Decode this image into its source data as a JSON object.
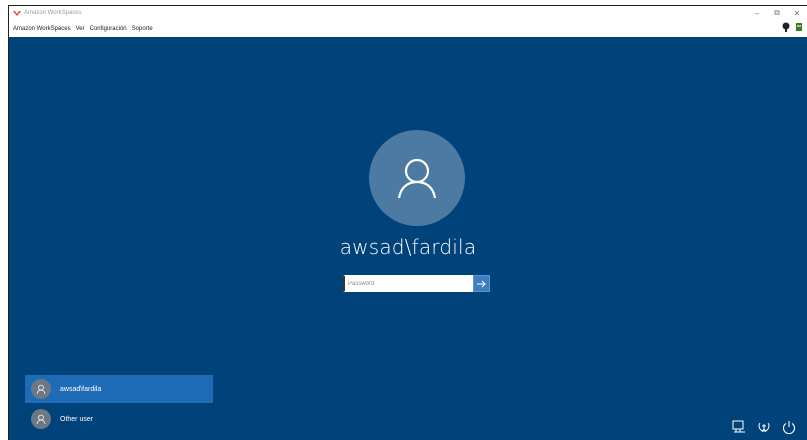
{
  "window": {
    "title": "Amazon WorkSpaces",
    "controls": {
      "minimize": "–",
      "restore": "⧉",
      "close": "✕"
    }
  },
  "menu": {
    "items": [
      "Amazon WorkSpaces",
      "Ver",
      "Configuración",
      "Soporte"
    ]
  },
  "login": {
    "username": "awsad\\fardila",
    "password_placeholder": "Password",
    "password_value": "",
    "submit_icon": "arrow-right-icon"
  },
  "users": [
    {
      "name": "awsad\\fardila",
      "selected": true
    },
    {
      "name": "Other user",
      "selected": false
    }
  ],
  "system_icons": [
    "network-icon",
    "ease-of-access-icon",
    "power-icon"
  ],
  "colors": {
    "background": "#00427a",
    "avatar": "#4d7aa3",
    "selected_tile": "#1e6bb8",
    "submit": "#3d7ec0"
  }
}
